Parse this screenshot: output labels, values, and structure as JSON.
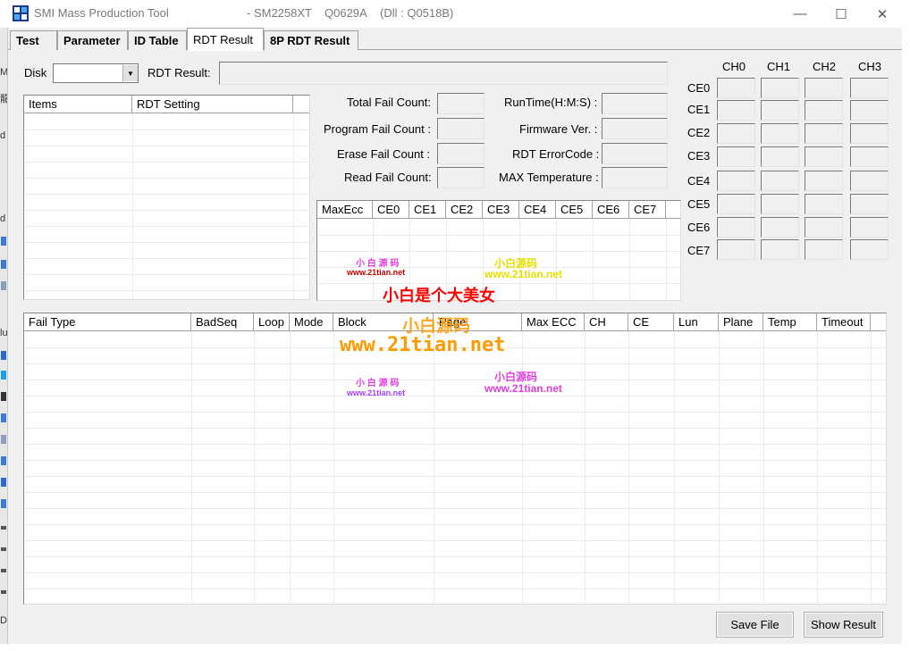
{
  "window": {
    "title": "SMI Mass Production Tool",
    "controller": "- SM2258XT",
    "firmware": "Q0629A",
    "dll": "(Dll : Q0518B)",
    "minimize_glyph": "—",
    "maximize_glyph": "☐",
    "close_glyph": "✕"
  },
  "left_strip": {
    "fragments": [
      "M",
      "龍",
      "d",
      "d",
      "lu",
      "rf",
      "D"
    ]
  },
  "tabs": [
    {
      "label": "Test",
      "active": false
    },
    {
      "label": "Parameter",
      "active": false
    },
    {
      "label": "ID Table",
      "active": false
    },
    {
      "label": "RDT Result",
      "active": true
    },
    {
      "label": "8P RDT Result",
      "active": false
    }
  ],
  "disk": {
    "label": "Disk",
    "value": "",
    "arrow": "▼"
  },
  "rdt_result": {
    "label": "RDT Result:",
    "value": ""
  },
  "items_table": {
    "columns": [
      "Items",
      "RDT Setting"
    ],
    "rows": []
  },
  "counters": {
    "total_fail": {
      "label": "Total Fail Count:",
      "value": ""
    },
    "program_fail": {
      "label": "Program Fail Count :",
      "value": ""
    },
    "erase_fail": {
      "label": "Erase Fail Count :",
      "value": ""
    },
    "read_fail": {
      "label": "Read Fail Count:",
      "value": ""
    },
    "runtime": {
      "label": "RunTime(H:M:S) :",
      "value": ""
    },
    "firmware_ver": {
      "label": "Firmware Ver. :",
      "value": ""
    },
    "rdt_errorcode": {
      "label": "RDT ErrorCode :",
      "value": ""
    },
    "max_temperature": {
      "label": "MAX Temperature :",
      "value": ""
    }
  },
  "maxecc_table": {
    "columns": [
      "MaxEcc",
      "CE0",
      "CE1",
      "CE2",
      "CE3",
      "CE4",
      "CE5",
      "CE6",
      "CE7"
    ],
    "rows": []
  },
  "ch_grid": {
    "channels": [
      "CH0",
      "CH1",
      "CH2",
      "CH3"
    ],
    "ces": [
      "CE0",
      "CE1",
      "CE2",
      "CE3",
      "CE4",
      "CE5",
      "CE6",
      "CE7"
    ]
  },
  "fail_table": {
    "columns": [
      "Fail Type",
      "BadSeq",
      "Loop",
      "Mode",
      "Block",
      "Page",
      "Max ECC",
      "CH",
      "CE",
      "Lun",
      "Plane",
      "Temp",
      "Timeout"
    ],
    "rows": []
  },
  "buttons": {
    "save_file": "Save File",
    "show_result": "Show Result"
  },
  "watermarks": {
    "brand_a": "小 白 源 码",
    "url_a": "www.21tian.net",
    "brand_b": "小白源码",
    "url_b": "www.21tian.net",
    "slogan": "小白是个大美女",
    "big_brand": "小白源码",
    "big_url": "www.21tian.net",
    "brand_c": "小 白 源 码",
    "url_c": "www.21tian.net",
    "brand_d": "小白源码",
    "url_d": "www.21tian.net"
  },
  "colors": {
    "dialog_bg": "#f0f0f0",
    "watermark_magenta": "#e040e0",
    "watermark_yellow": "#e8e000",
    "watermark_red": "#ff0000",
    "watermark_orange": "#ff9a00",
    "watermark_purple": "#a040ff",
    "watermark_darkred": "#c00000"
  }
}
